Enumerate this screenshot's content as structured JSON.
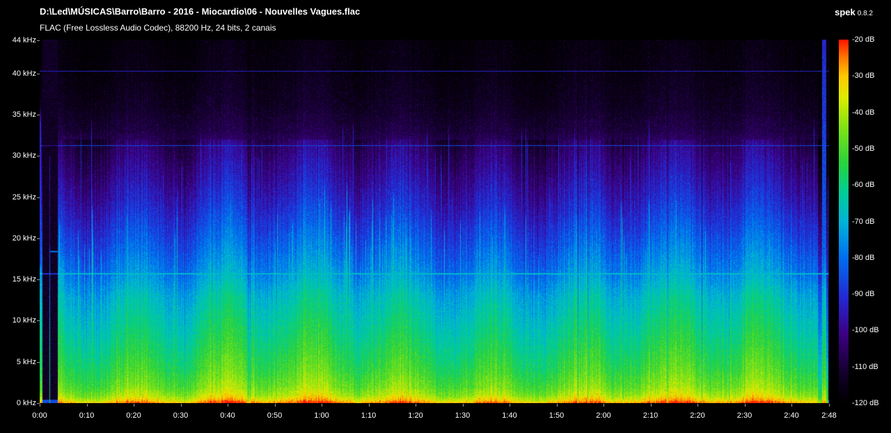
{
  "header": {
    "file_path": "D:\\Led\\MÚSICAS\\Barro\\Barro - 2016 - Miocardio\\06 - Nouvelles Vagues.flac",
    "app_name": "spek",
    "app_version": "0.8.2",
    "format_info": "FLAC (Free Lossless Audio Codec), 88200 Hz, 24 bits, 2 canais"
  },
  "axes": {
    "frequency": {
      "unit": "kHz",
      "max_khz": 44.1,
      "ticks": [
        {
          "khz": 44,
          "label": "44 kHz"
        },
        {
          "khz": 40,
          "label": "40 kHz"
        },
        {
          "khz": 35,
          "label": "35 kHz"
        },
        {
          "khz": 30,
          "label": "30 kHz"
        },
        {
          "khz": 25,
          "label": "25 kHz"
        },
        {
          "khz": 20,
          "label": "20 kHz"
        },
        {
          "khz": 15,
          "label": "15 kHz"
        },
        {
          "khz": 10,
          "label": "10 kHz"
        },
        {
          "khz": 5,
          "label": "5 kHz"
        },
        {
          "khz": 0,
          "label": "0 kHz"
        }
      ]
    },
    "time": {
      "duration_s": 168,
      "ticks": [
        {
          "sec": 0,
          "label": "0:00"
        },
        {
          "sec": 10,
          "label": "0:10"
        },
        {
          "sec": 20,
          "label": "0:20"
        },
        {
          "sec": 30,
          "label": "0:30"
        },
        {
          "sec": 40,
          "label": "0:40"
        },
        {
          "sec": 50,
          "label": "0:50"
        },
        {
          "sec": 60,
          "label": "1:00"
        },
        {
          "sec": 70,
          "label": "1:10"
        },
        {
          "sec": 80,
          "label": "1:20"
        },
        {
          "sec": 90,
          "label": "1:30"
        },
        {
          "sec": 100,
          "label": "1:40"
        },
        {
          "sec": 110,
          "label": "1:50"
        },
        {
          "sec": 120,
          "label": "2:00"
        },
        {
          "sec": 130,
          "label": "2:10"
        },
        {
          "sec": 140,
          "label": "2:20"
        },
        {
          "sec": 150,
          "label": "2:30"
        },
        {
          "sec": 160,
          "label": "2:40"
        },
        {
          "sec": 168,
          "label": "2:48"
        }
      ]
    },
    "level": {
      "unit": "dB",
      "ticks": [
        {
          "db": -20,
          "label": "-20 dB"
        },
        {
          "db": -30,
          "label": "-30 dB"
        },
        {
          "db": -40,
          "label": "-40 dB"
        },
        {
          "db": -50,
          "label": "-50 dB"
        },
        {
          "db": -60,
          "label": "-60 dB"
        },
        {
          "db": -70,
          "label": "-70 dB"
        },
        {
          "db": -80,
          "label": "-80 dB"
        },
        {
          "db": -90,
          "label": "-90 dB"
        },
        {
          "db": -100,
          "label": "-100 dB"
        },
        {
          "db": -110,
          "label": "-110 dB"
        },
        {
          "db": -120,
          "label": "-120 dB"
        }
      ]
    }
  },
  "chart_data": {
    "type": "heatmap",
    "title": "Audio spectrogram (spek)",
    "x_axis": "time 0:00 – 2:48",
    "y_axis": "frequency 0 – 44 kHz",
    "color_axis": "level -120 dB to -20 dB",
    "notes": "Loud broadband music: red/orange floor below ~500 Hz, green energy to ~10-13 kHz, dense vertical transient streaks reaching 15-30 kHz, blue band 16-31 kHz, near-black above ~33 kHz; horizontal artifact lines at ~15.7, ~31.3 and ~40.3 kHz; quiet intro until ~0:04 with one thin spike at ~0:02; tall blue burst at ~2:47"
  },
  "spectrogram": {
    "seed": 1337,
    "duration_s": 168,
    "freq_max_hz": 44100,
    "db_range": [
      -120,
      -20
    ],
    "palette": [
      [
        0.0,
        0,
        0,
        0
      ],
      [
        0.08,
        18,
        0,
        40
      ],
      [
        0.19,
        60,
        0,
        130
      ],
      [
        0.29,
        36,
        40,
        210
      ],
      [
        0.4,
        0,
        110,
        240
      ],
      [
        0.5,
        0,
        180,
        215
      ],
      [
        0.58,
        0,
        205,
        150
      ],
      [
        0.66,
        40,
        210,
        60
      ],
      [
        0.75,
        120,
        225,
        25
      ],
      [
        0.84,
        220,
        235,
        0
      ],
      [
        0.9,
        255,
        200,
        0
      ],
      [
        0.95,
        255,
        120,
        0
      ],
      [
        1.0,
        255,
        20,
        0
      ]
    ],
    "base_spectrum_db": [
      [
        0,
        -24
      ],
      [
        150,
        -27
      ],
      [
        400,
        -33
      ],
      [
        1000,
        -40
      ],
      [
        2000,
        -46
      ],
      [
        4000,
        -52
      ],
      [
        7000,
        -58
      ],
      [
        10000,
        -63
      ],
      [
        13000,
        -68
      ],
      [
        16000,
        -76
      ],
      [
        20000,
        -84
      ],
      [
        24000,
        -92
      ],
      [
        28000,
        -99
      ],
      [
        31000,
        -104
      ],
      [
        33000,
        -109
      ],
      [
        36000,
        -113
      ],
      [
        40000,
        -116
      ],
      [
        44100,
        -118
      ]
    ],
    "artifact_lines": [
      {
        "hz": 15700,
        "half_width_hz": 75,
        "level_db": -68,
        "quiet_level_db": -90
      },
      {
        "hz": 31300,
        "half_width_hz": 65,
        "level_db": -86,
        "quiet_level_db": -98
      },
      {
        "hz": 40300,
        "half_width_hz": 55,
        "level_db": -92,
        "quiet_level_db": -93
      }
    ],
    "intro_silence_s": [
      0.55,
      3.8
    ],
    "intro_spike_s": 2.12,
    "outro_burst_s": [
      166.55,
      167.45
    ]
  }
}
